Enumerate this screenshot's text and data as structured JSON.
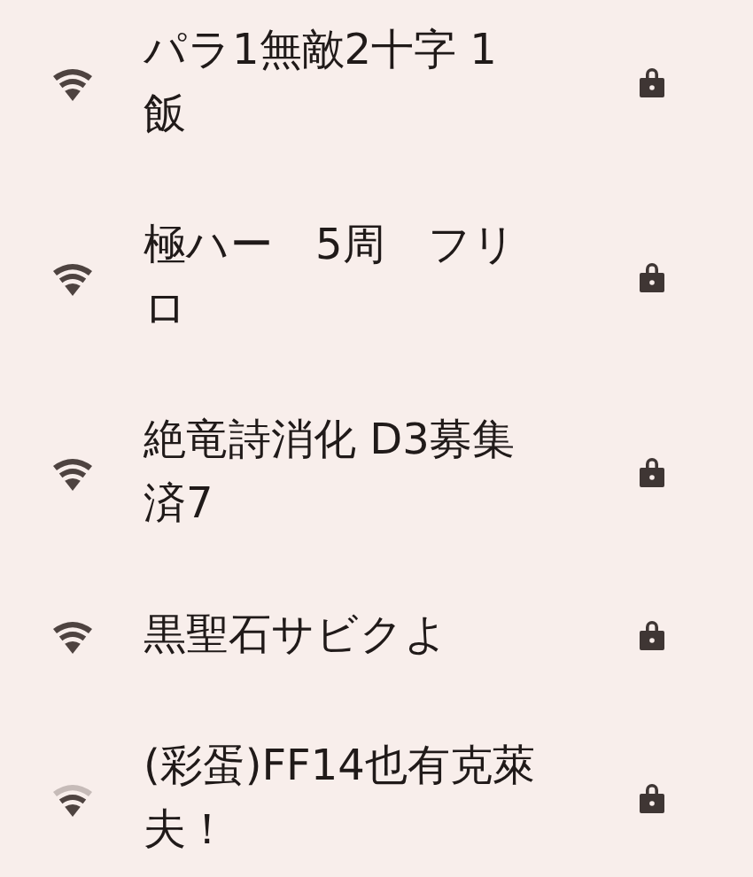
{
  "networks": [
    {
      "name": "パラ1無敵2十字 1飯",
      "kind": "full",
      "locked": true
    },
    {
      "name": "極ハー　5周　フリロ",
      "kind": "full",
      "locked": true
    },
    {
      "name": "絶竜詩消化 D3募集済7",
      "kind": "full",
      "locked": true
    },
    {
      "name": "黒聖石サビクよ",
      "kind": "full",
      "locked": true
    },
    {
      "name": "(彩蛋)FF14也有克萊夫！",
      "kind": "weak",
      "locked": true
    }
  ]
}
